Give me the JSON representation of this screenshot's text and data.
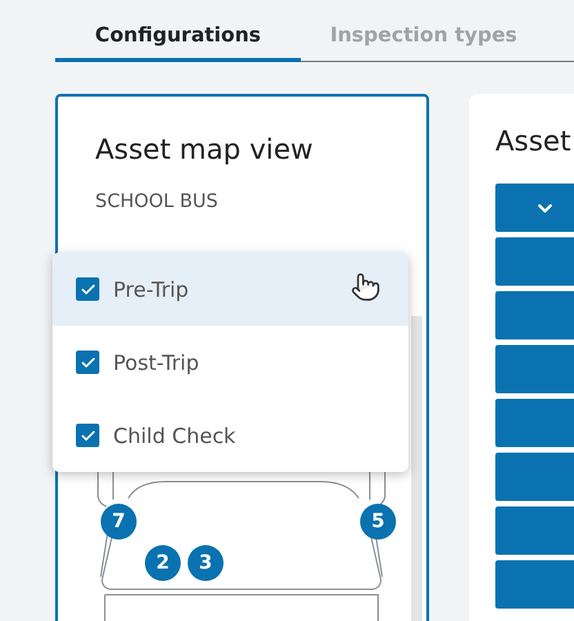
{
  "tabs": [
    {
      "label": "Configurations",
      "selected": true
    },
    {
      "label": "Inspection types",
      "selected": false
    }
  ],
  "asset_map_card": {
    "title": "Asset map view",
    "subtitle": "SCHOOL BUS",
    "inspection_menu": [
      {
        "label": "Pre-Trip",
        "checked": true,
        "selected": true
      },
      {
        "label": "Post-Trip",
        "checked": true,
        "selected": false
      },
      {
        "label": "Child Check",
        "checked": true,
        "selected": false
      }
    ],
    "markers": [
      {
        "label": "7"
      },
      {
        "label": "5"
      },
      {
        "label": "2"
      },
      {
        "label": "3"
      }
    ]
  },
  "asset_card": {
    "title": "Asset"
  }
}
